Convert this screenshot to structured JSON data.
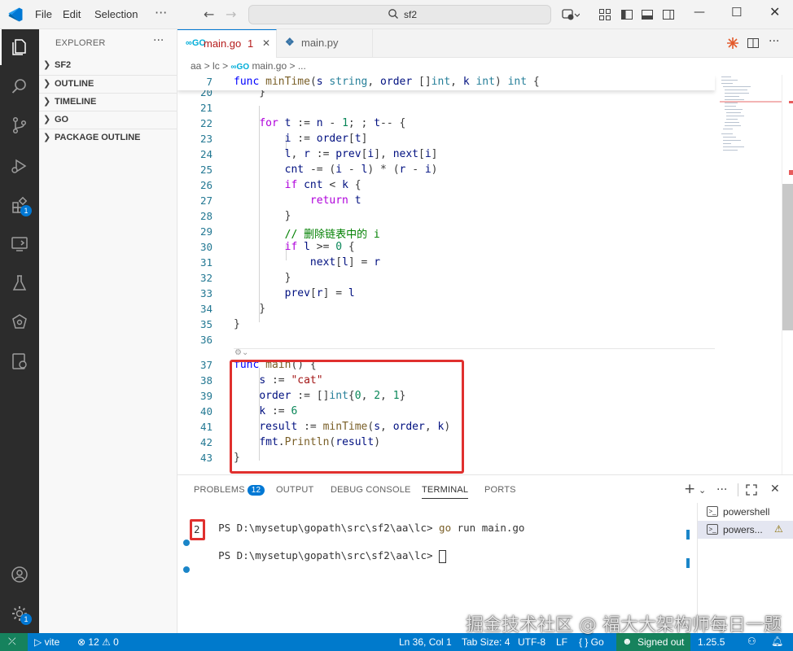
{
  "menu": {
    "file": "File",
    "edit": "Edit",
    "selection": "Selection",
    "more": "···"
  },
  "search": {
    "text": "sf2"
  },
  "sidebar": {
    "title": "EXPLORER",
    "more": "···",
    "sections": [
      {
        "label": "SF2"
      },
      {
        "label": "OUTLINE"
      },
      {
        "label": "TIMELINE"
      },
      {
        "label": "GO"
      },
      {
        "label": "PACKAGE OUTLINE"
      }
    ]
  },
  "activity": {
    "extensions_badge": "1",
    "settings_badge": "1"
  },
  "tabs": [
    {
      "name": "main.go",
      "problems": "1",
      "icon": "go-file-icon"
    },
    {
      "name": "main.py",
      "icon": "python-file-icon"
    }
  ],
  "breadcrumb": {
    "p1": "aa",
    "p2": "lc",
    "p3": "main.go",
    "p4": "..."
  },
  "editor": {
    "sticky": {
      "num": "7",
      "tokens": [
        [
          "kw",
          "func "
        ],
        [
          "fn",
          "minTime"
        ],
        [
          "",
          "("
        ],
        [
          "vr",
          "s "
        ],
        [
          "ty",
          "string"
        ],
        [
          "",
          ", "
        ],
        [
          "vr",
          "order "
        ],
        [
          "",
          "[]"
        ],
        [
          "ty",
          "int"
        ],
        [
          "",
          ", "
        ],
        [
          "vr",
          "k "
        ],
        [
          "ty",
          "int"
        ],
        [
          "",
          ") "
        ],
        [
          "ty",
          "int"
        ],
        [
          "",
          " {"
        ]
      ]
    },
    "lines": [
      {
        "num": "20",
        "tokens": [
          [
            "",
            "    }"
          ]
        ]
      },
      {
        "num": "21",
        "tokens": []
      },
      {
        "num": "22",
        "tokens": [
          [
            "",
            "    "
          ],
          [
            "ctl",
            "for "
          ],
          [
            "vr",
            "t "
          ],
          [
            "",
            ":= "
          ],
          [
            "vr",
            "n "
          ],
          [
            "",
            "- "
          ],
          [
            "nm",
            "1"
          ],
          [
            "",
            "; ; "
          ],
          [
            "vr",
            "t"
          ],
          [
            "",
            "-- {"
          ]
        ]
      },
      {
        "num": "23",
        "tokens": [
          [
            "",
            "        "
          ],
          [
            "vr",
            "i "
          ],
          [
            "",
            ":= "
          ],
          [
            "vr",
            "order"
          ],
          [
            "",
            "["
          ],
          [
            "vr",
            "t"
          ],
          [
            "",
            "]"
          ]
        ]
      },
      {
        "num": "24",
        "tokens": [
          [
            "",
            "        "
          ],
          [
            "vr",
            "l"
          ],
          [
            "",
            ", "
          ],
          [
            "vr",
            "r "
          ],
          [
            "",
            ":= "
          ],
          [
            "vr",
            "prev"
          ],
          [
            "",
            "["
          ],
          [
            "vr",
            "i"
          ],
          [
            "",
            "], "
          ],
          [
            "vr",
            "next"
          ],
          [
            "",
            "["
          ],
          [
            "vr",
            "i"
          ],
          [
            "",
            "]"
          ]
        ]
      },
      {
        "num": "25",
        "tokens": [
          [
            "",
            "        "
          ],
          [
            "vr",
            "cnt "
          ],
          [
            "",
            "-= ("
          ],
          [
            "vr",
            "i "
          ],
          [
            "",
            "- "
          ],
          [
            "vr",
            "l"
          ],
          [
            "",
            ") * ("
          ],
          [
            "vr",
            "r "
          ],
          [
            "",
            "- "
          ],
          [
            "vr",
            "i"
          ],
          [
            "",
            ")"
          ]
        ]
      },
      {
        "num": "26",
        "tokens": [
          [
            "",
            "        "
          ],
          [
            "ctl",
            "if "
          ],
          [
            "vr",
            "cnt "
          ],
          [
            "",
            "< "
          ],
          [
            "vr",
            "k "
          ],
          [
            "",
            "{"
          ]
        ]
      },
      {
        "num": "27",
        "tokens": [
          [
            "",
            "            "
          ],
          [
            "ctl",
            "return "
          ],
          [
            "vr",
            "t"
          ]
        ]
      },
      {
        "num": "28",
        "tokens": [
          [
            "",
            "        }"
          ]
        ]
      },
      {
        "num": "29",
        "tokens": [
          [
            "",
            "        "
          ],
          [
            "cm",
            "// 删除链表中的 i"
          ]
        ]
      },
      {
        "num": "30",
        "tokens": [
          [
            "",
            "        "
          ],
          [
            "ctl",
            "if "
          ],
          [
            "vr",
            "l "
          ],
          [
            "",
            ">= "
          ],
          [
            "nm",
            "0"
          ],
          [
            "",
            " {"
          ]
        ]
      },
      {
        "num": "31",
        "tokens": [
          [
            "",
            "            "
          ],
          [
            "vr",
            "next"
          ],
          [
            "",
            "["
          ],
          [
            "vr",
            "l"
          ],
          [
            "",
            "] = "
          ],
          [
            "vr",
            "r"
          ]
        ]
      },
      {
        "num": "32",
        "tokens": [
          [
            "",
            "        }"
          ]
        ]
      },
      {
        "num": "33",
        "tokens": [
          [
            "",
            "        "
          ],
          [
            "vr",
            "prev"
          ],
          [
            "",
            "["
          ],
          [
            "vr",
            "r"
          ],
          [
            "",
            "] = "
          ],
          [
            "vr",
            "l"
          ]
        ]
      },
      {
        "num": "34",
        "tokens": [
          [
            "",
            "    }"
          ]
        ]
      },
      {
        "num": "35",
        "tokens": [
          [
            "",
            "}"
          ]
        ]
      },
      {
        "num": "36",
        "tokens": []
      },
      {
        "num": "37",
        "tokens": [
          [
            "kw",
            "func "
          ],
          [
            "fn",
            "main"
          ],
          [
            "",
            "() {"
          ]
        ]
      },
      {
        "num": "38",
        "tokens": [
          [
            "",
            "    "
          ],
          [
            "vr",
            "s "
          ],
          [
            "",
            ":= "
          ],
          [
            "st",
            "\"cat\""
          ]
        ]
      },
      {
        "num": "39",
        "tokens": [
          [
            "",
            "    "
          ],
          [
            "vr",
            "order "
          ],
          [
            "",
            ":= []"
          ],
          [
            "ty",
            "int"
          ],
          [
            "",
            "{"
          ],
          [
            "nm",
            "0"
          ],
          [
            "",
            ", "
          ],
          [
            "nm",
            "2"
          ],
          [
            "",
            ", "
          ],
          [
            "nm",
            "1"
          ],
          [
            "",
            "}"
          ]
        ]
      },
      {
        "num": "40",
        "tokens": [
          [
            "",
            "    "
          ],
          [
            "vr",
            "k "
          ],
          [
            "",
            ":= "
          ],
          [
            "nm",
            "6"
          ]
        ]
      },
      {
        "num": "41",
        "tokens": [
          [
            "",
            "    "
          ],
          [
            "vr",
            "result "
          ],
          [
            "",
            ":= "
          ],
          [
            "fn",
            "minTime"
          ],
          [
            "",
            "("
          ],
          [
            "vr",
            "s"
          ],
          [
            "",
            ", "
          ],
          [
            "vr",
            "order"
          ],
          [
            "",
            ", "
          ],
          [
            "vr",
            "k"
          ],
          [
            "",
            ")"
          ]
        ]
      },
      {
        "num": "42",
        "tokens": [
          [
            "",
            "    "
          ],
          [
            "vr",
            "fmt"
          ],
          [
            "",
            "."
          ],
          [
            "fn",
            "Println"
          ],
          [
            "",
            "("
          ],
          [
            "vr",
            "result"
          ],
          [
            "",
            ")"
          ]
        ]
      },
      {
        "num": "43",
        "tokens": [
          [
            "",
            "}"
          ]
        ]
      }
    ]
  },
  "panel": {
    "tabs": {
      "problems": "PROBLEMS",
      "problems_count": "12",
      "output": "OUTPUT",
      "debug": "DEBUG CONSOLE",
      "terminal": "TERMINAL",
      "ports": "PORTS"
    },
    "terminal": {
      "line1_prompt": "PS D:\\mysetup\\gopath\\src\\sf2\\aa\\lc> ",
      "line1_cmd": "go",
      "line1_args": " run main.go",
      "line2": "2",
      "line3_prompt": "PS D:\\mysetup\\gopath\\src\\sf2\\aa\\lc> "
    },
    "terminals": [
      {
        "name": "powershell"
      },
      {
        "name": "powers...",
        "warn": "⚠"
      }
    ]
  },
  "status": {
    "vite": "vite",
    "problems": "⊗ 12 ⚠ 0",
    "position": "Ln 36, Col 1",
    "tabsize": "Tab Size: 4",
    "encoding": "UTF-8",
    "eol": "LF",
    "lang": "{ } Go",
    "signed": "Signed out",
    "version": "1.25.5"
  },
  "watermark": "掘金技术社区 @ 福大大架构师每日一题"
}
